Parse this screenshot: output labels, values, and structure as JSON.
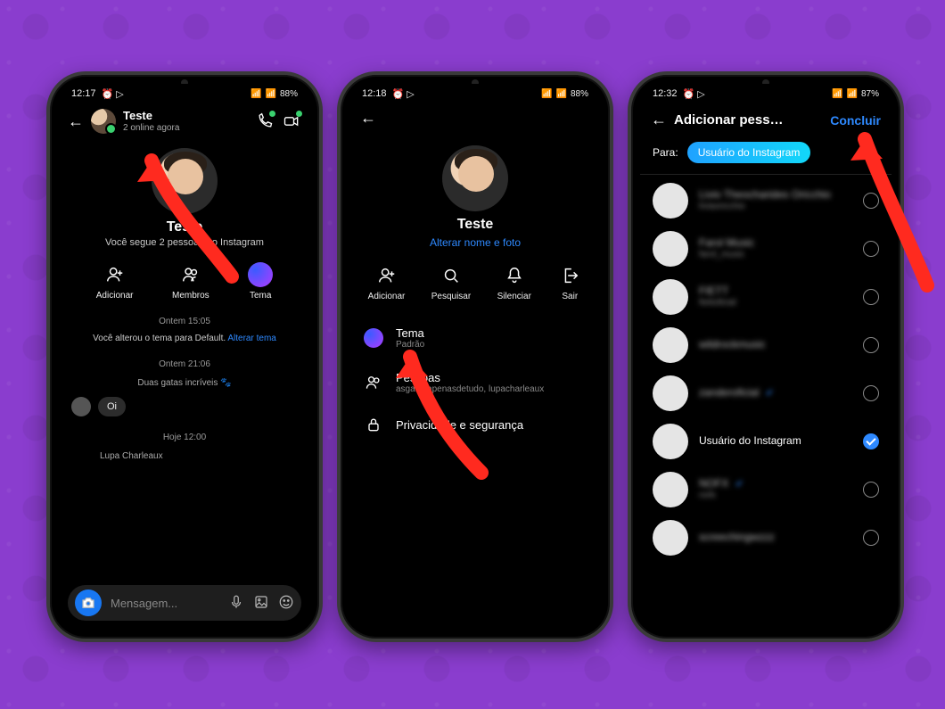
{
  "phone1": {
    "status": {
      "time": "12:17",
      "battery": "88%",
      "icons": "⏰ ▷"
    },
    "header": {
      "title": "Teste",
      "subtitle": "2 online agora"
    },
    "group": {
      "name": "Teste",
      "subline": "Você segue 2 pessoas no Instagram"
    },
    "actions": {
      "add": "Adicionar",
      "members": "Membros",
      "theme": "Tema"
    },
    "timeline": {
      "ts1": "Ontem 15:05",
      "sys1_a": "Você alterou o tema para Default. ",
      "sys1_b": "Alterar tema",
      "ts2": "Ontem 21:06",
      "thread_name": "Duas gatas incríveis 🐾",
      "msg1": "Oi",
      "ts3": "Hoje 12:00",
      "sender2": "Lupa Charleaux"
    },
    "composer": {
      "placeholder": "Mensagem..."
    }
  },
  "phone2": {
    "status": {
      "time": "12:18",
      "battery": "88%",
      "icons": "⏰ ▷"
    },
    "group": {
      "name": "Teste",
      "change": "Alterar nome e foto"
    },
    "actions": {
      "add": "Adicionar",
      "search": "Pesquisar",
      "mute": "Silenciar",
      "leave": "Sair"
    },
    "rows": {
      "theme_label": "Tema",
      "theme_value": "Padrão",
      "people_label": "Pessoas",
      "people_value": "asgatasapenasdetudo, lupacharleaux",
      "privacy_label": "Privacidade e segurança"
    }
  },
  "phone3": {
    "status": {
      "time": "12:32",
      "battery": "87%",
      "icons": "⏰ ▷"
    },
    "header": {
      "title": "Adicionar pess…",
      "done": "Concluir"
    },
    "para": {
      "label": "Para:",
      "pill": "Usuário do Instagram"
    },
    "users": [
      {
        "name": "Livio Theocharides Oricchio",
        "handle": "liviaoricchio",
        "blurred": true,
        "selected": false,
        "verified": false
      },
      {
        "name": "Farol Music",
        "handle": "farol_music",
        "blurred": true,
        "selected": false,
        "verified": false
      },
      {
        "name": "FIETT",
        "handle": "fiettoficial",
        "blurred": true,
        "selected": false,
        "verified": false
      },
      {
        "name": "wildrockmusic",
        "handle": "",
        "blurred": true,
        "selected": false,
        "verified": false
      },
      {
        "name": "zanderoficial",
        "handle": "",
        "blurred": true,
        "selected": false,
        "verified": true
      },
      {
        "name": "Usuário do Instagram",
        "handle": "",
        "blurred": false,
        "selected": true,
        "verified": false
      },
      {
        "name": "NOFX",
        "handle": "nofx",
        "blurred": true,
        "selected": false,
        "verified": true
      },
      {
        "name": "screechingwzzz",
        "handle": "",
        "blurred": true,
        "selected": false,
        "verified": false
      }
    ]
  }
}
